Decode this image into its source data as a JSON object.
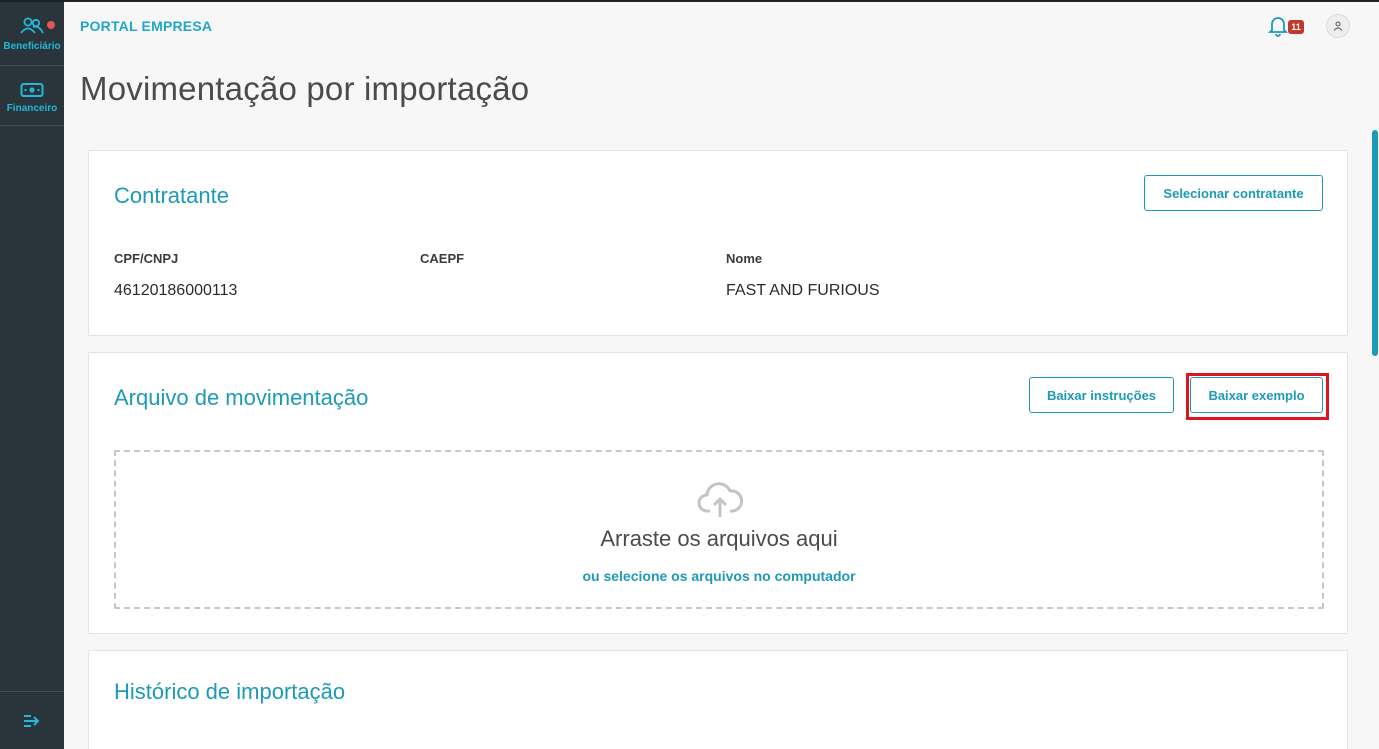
{
  "sidebar": {
    "items": [
      {
        "label": "Beneficiário",
        "icon": "users-icon"
      },
      {
        "label": "Financeiro",
        "icon": "money-icon"
      }
    ],
    "collapse_icon": "collapse-menu-icon"
  },
  "header": {
    "brand": "PORTAL EMPRESA",
    "notifications_count": "11"
  },
  "page": {
    "title": "Movimentação por importação"
  },
  "contratante": {
    "title": "Contratante",
    "select_button": "Selecionar contratante",
    "fields": [
      {
        "label": "CPF/CNPJ",
        "value": "46120186000113"
      },
      {
        "label": "CAEPF",
        "value": ""
      },
      {
        "label": "Nome",
        "value": "FAST AND FURIOUS"
      }
    ]
  },
  "arquivo": {
    "title": "Arquivo de movimentação",
    "instructions_button": "Baixar instruções",
    "example_button": "Baixar exemplo",
    "drop_title": "Arraste os arquivos aqui",
    "drop_link": "ou selecione os arquivos no computador"
  },
  "historico": {
    "title": "Histórico de importação"
  },
  "colors": {
    "accent": "#1d9ab8",
    "sidebar_bg": "#29353a",
    "highlight": "#e0141e",
    "badge": "#c0392b"
  }
}
